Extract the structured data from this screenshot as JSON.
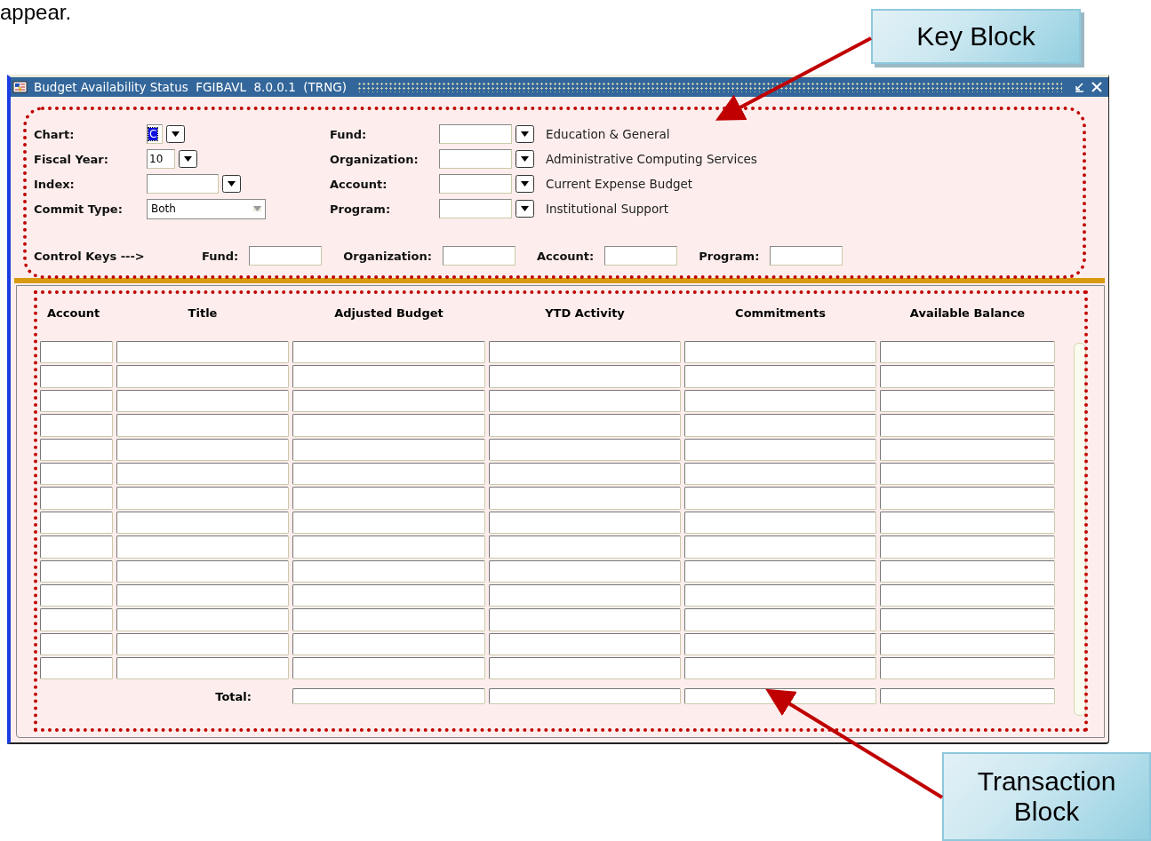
{
  "document": {
    "text_above": "appear."
  },
  "callouts": [
    {
      "kind": "key",
      "label": "Key Block"
    },
    {
      "kind": "transaction",
      "label": "Transaction Block"
    }
  ],
  "window": {
    "title": "Budget Availability Status  FGIBAVL  8.0.0.1  (TRNG)"
  },
  "key_block": {
    "left_fields": [
      {
        "kind": "lookup",
        "label": "Chart:",
        "value": "C",
        "highlighted": true
      },
      {
        "kind": "lookup",
        "label": "Fiscal Year:",
        "value": "10"
      },
      {
        "kind": "lookup",
        "label": "Index:"
      },
      {
        "kind": "select",
        "label": "Commit Type:",
        "value": "Both"
      }
    ],
    "right_fields": [
      {
        "label": "Fund:",
        "description": "Education & General"
      },
      {
        "label": "Organization:",
        "description": "Administrative Computing Services"
      },
      {
        "label": "Account:",
        "description": "Current Expense Budget"
      },
      {
        "label": "Program:",
        "description": "Institutional Support"
      }
    ],
    "control_keys": {
      "label": "Control Keys --->",
      "fields": [
        {
          "label": "Fund:"
        },
        {
          "label": "Organization:"
        },
        {
          "label": "Account:"
        },
        {
          "label": "Program:"
        }
      ]
    }
  },
  "transaction_block": {
    "columns": [
      "Account",
      "Title",
      "Adjusted Budget",
      "YTD Activity",
      "Commitments",
      "Available Balance"
    ],
    "total_label": "Total:"
  }
}
